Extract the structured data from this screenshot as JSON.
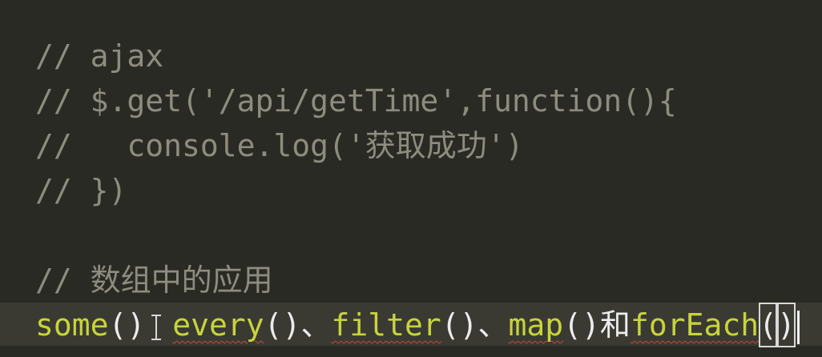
{
  "editor": {
    "lines": [
      "// ajax",
      "// $.get('/api/getTime',function(){",
      "//   console.log('获取成功')",
      "// })",
      "",
      "// 数组中的应用"
    ],
    "current_line": {
      "fn1": "some",
      "p1": "()",
      "fn2": "every",
      "p2": "()",
      "sep2": "、",
      "fn3": "filter",
      "p3": "()",
      "sep3": "、",
      "fn4": "map",
      "p4": "()",
      "and": "和",
      "fn5": "forEach",
      "p5_open": "(",
      "p5_close": ")"
    }
  }
}
